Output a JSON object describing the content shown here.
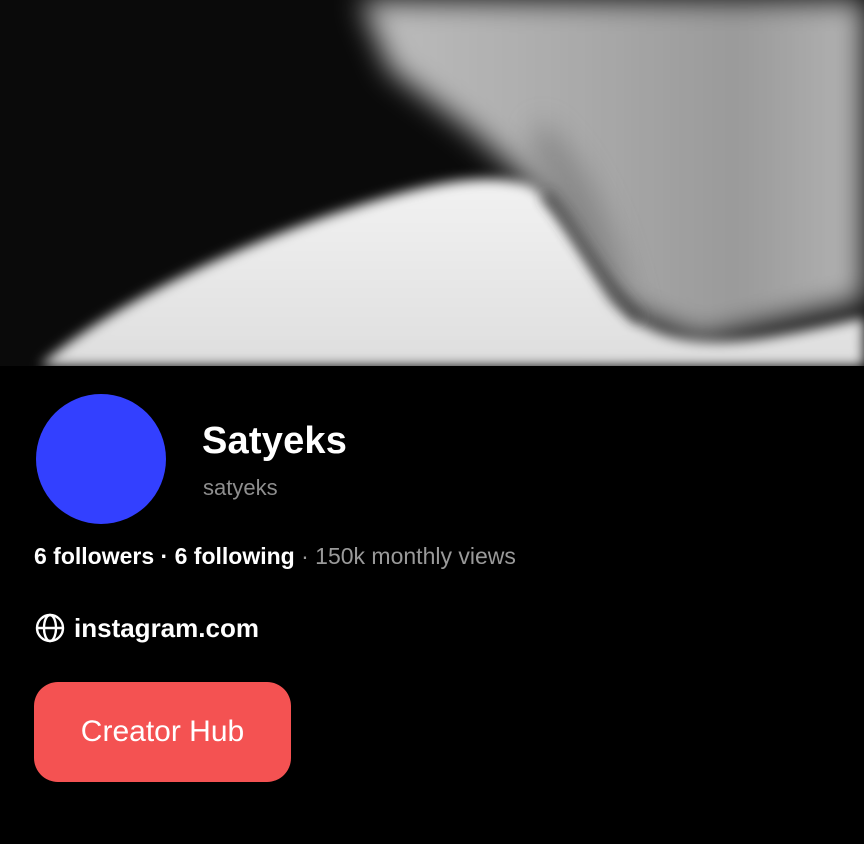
{
  "cover": {
    "image_alt": "cover-photo"
  },
  "profile": {
    "display_name": "Satyeks",
    "username": "satyeks",
    "avatar_color": "#3340ff",
    "stats": {
      "followers": "6 followers",
      "dot": "·",
      "following": "6 following",
      "views_dot": "·",
      "monthly_views": "150k monthly views"
    },
    "website": {
      "icon": "globe-icon",
      "label": "instagram.com"
    },
    "creator_hub_button": {
      "label": "Creator Hub",
      "color": "#f45252"
    }
  }
}
